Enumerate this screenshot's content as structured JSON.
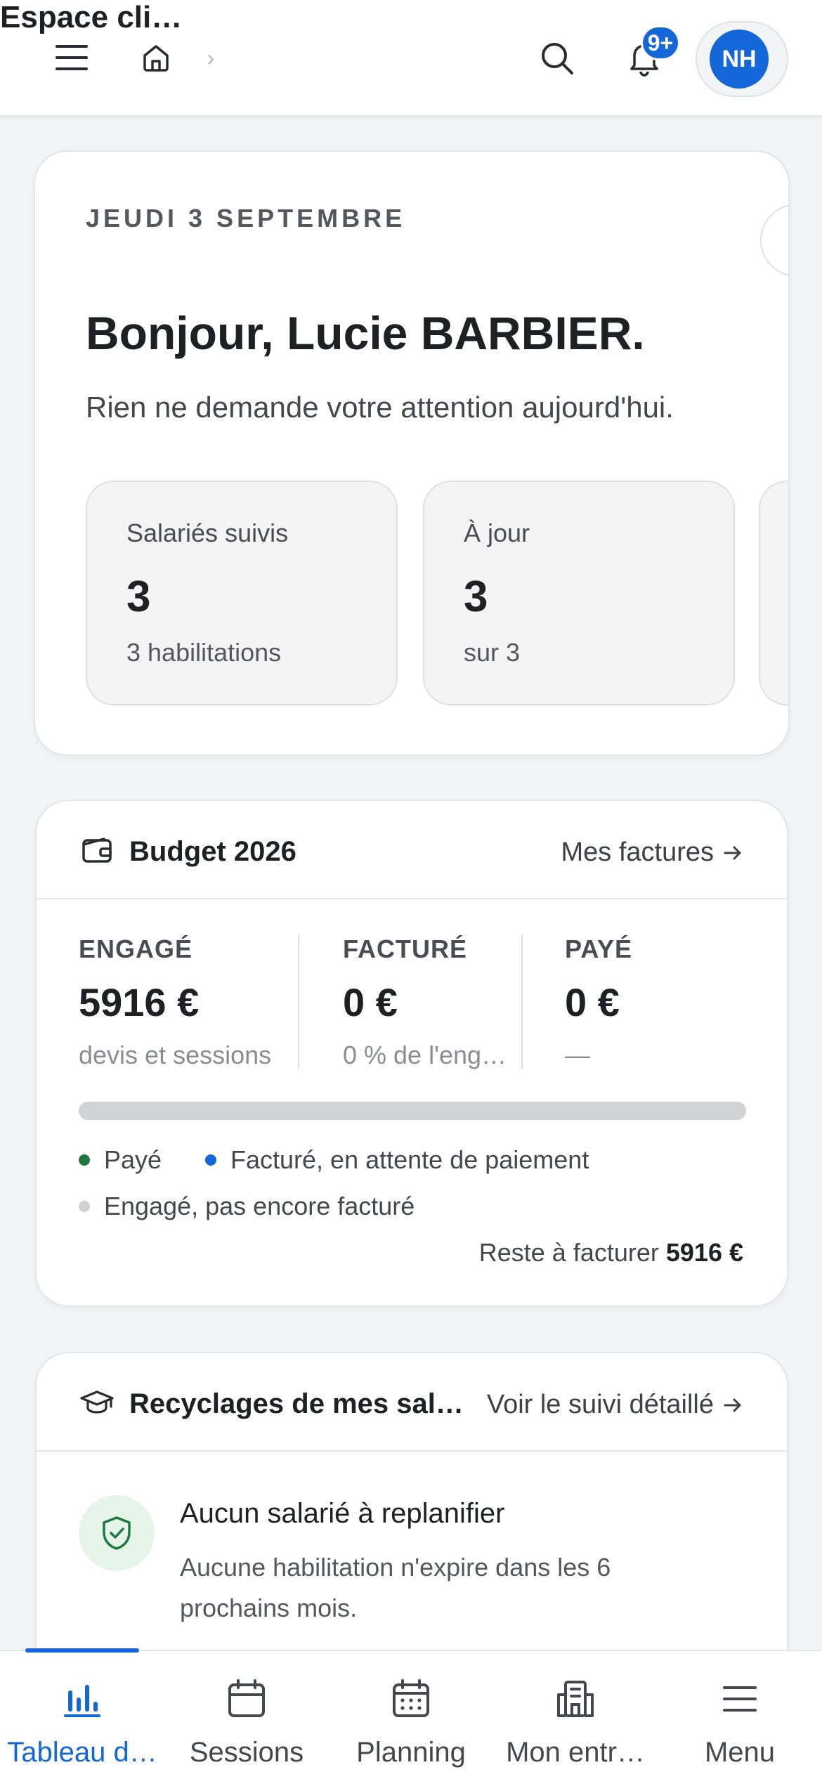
{
  "header": {
    "breadcrumb_title": "Espace cli…",
    "notification_badge": "9+",
    "avatar_initials": "NH"
  },
  "hero": {
    "date": "JEUDI 3 SEPTEMBRE",
    "greeting": "Bonjour, Lucie BARBIER.",
    "subtitle": "Rien ne demande votre attention aujourd'hui.",
    "stats": [
      {
        "label": "Salariés suivis",
        "value": "3",
        "sub": "3 habilitations"
      },
      {
        "label": "À jour",
        "value": "3",
        "sub": "sur 3"
      }
    ]
  },
  "budget": {
    "title": "Budget 2026",
    "link": "Mes factures",
    "columns": [
      {
        "label": "ENGAGÉ",
        "value": "5916 €",
        "sub": "devis et sessions"
      },
      {
        "label": "FACTURÉ",
        "value": "0 €",
        "sub": "0 % de l'eng…"
      },
      {
        "label": "PAYÉ",
        "value": "0 €",
        "sub": "—"
      }
    ],
    "paid_fraction": 0,
    "legend": [
      {
        "label": "Payé",
        "color": "#1c7a3e"
      },
      {
        "label": "Facturé, en attente de paiement",
        "color": "#1467d8"
      },
      {
        "label": "Engagé, pas encore facturé",
        "color": "#d1d2d5"
      }
    ],
    "remaining_label": "Reste à facturer",
    "remaining_value": "5916 €"
  },
  "recycling": {
    "title": "Recyclages de mes sal…",
    "link": "Voir le suivi détaillé",
    "empty_title": "Aucun salarié à replanifier",
    "empty_sub": "Aucune habilitation n'expire dans les 6 prochains mois."
  },
  "nav": {
    "items": [
      {
        "label": "Tableau d…",
        "icon": "bar-chart-icon"
      },
      {
        "label": "Sessions",
        "icon": "calendar-icon"
      },
      {
        "label": "Planning",
        "icon": "calendar-grid-icon"
      },
      {
        "label": "Mon entr…",
        "icon": "building-icon"
      },
      {
        "label": "Menu",
        "icon": "menu-icon"
      }
    ]
  },
  "colors": {
    "accent": "#1467d8",
    "paid": "#1c7a3e"
  }
}
